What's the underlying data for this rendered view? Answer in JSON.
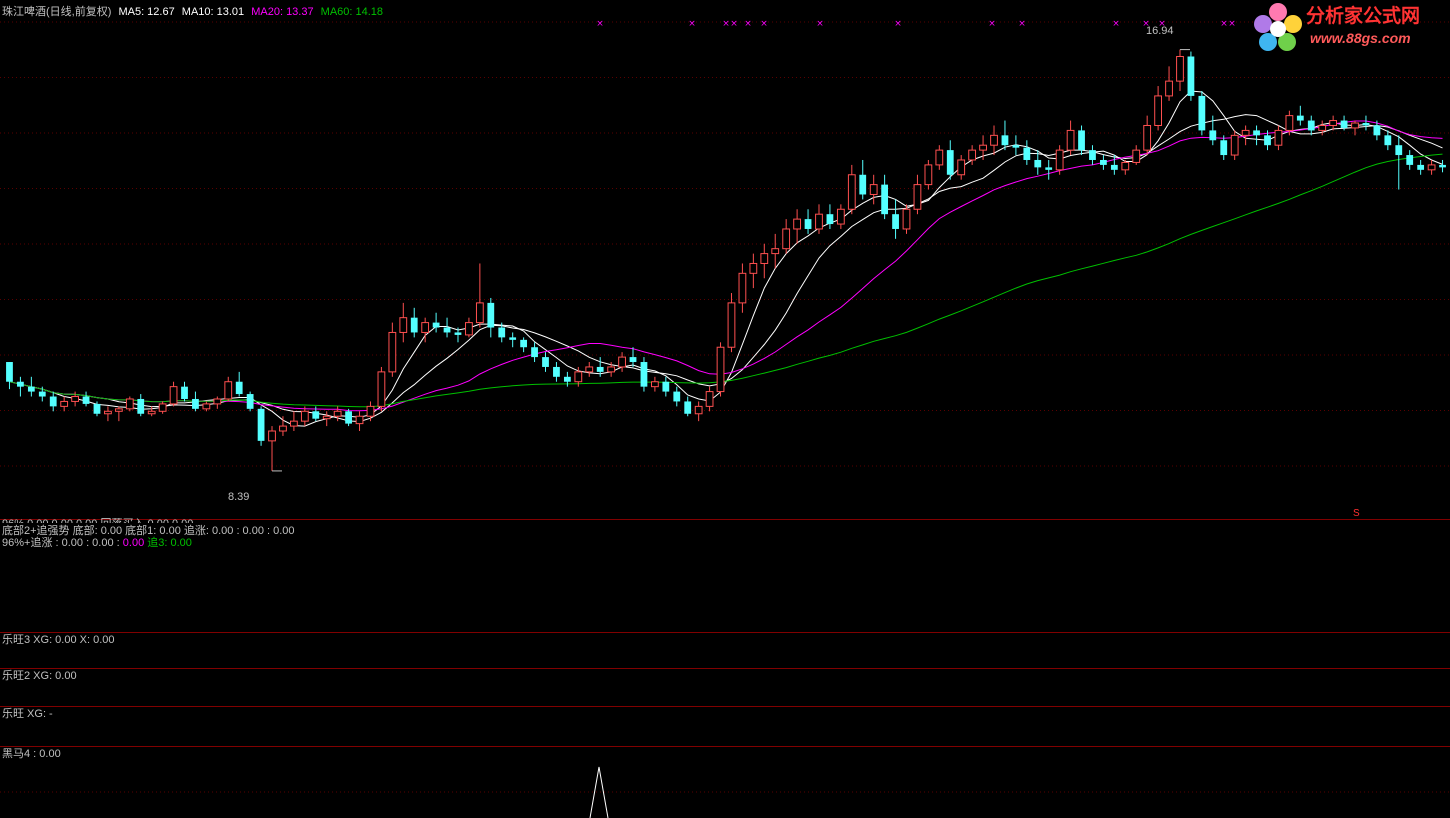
{
  "header": {
    "title": "珠江啤酒(日线,前复权)",
    "ma5": "MA5: 12.67",
    "ma10": "MA10: 13.01",
    "ma20": "MA20: 13.37",
    "ma60": "MA60: 14.18"
  },
  "logo": {
    "name": "分析家公式网",
    "url": "www.88gs.com"
  },
  "colors": {
    "up": "#ff5050",
    "down": "#54ffff",
    "ma5": "#ffffff",
    "ma10": "#ffffff",
    "ma20": "#ff00ff",
    "ma60": "#00c000",
    "divider": "#800000",
    "marker": "#ff00ff"
  },
  "panels": {
    "p1_line1": "底部2+追强势  底部: 0.00  底部1: 0.00  追涨: 0.00 : 0.00 : 0.00",
    "p1_line1_partial": "96%  0.00  0.00  0.00  回落买入  0.00  0.00",
    "p1_line2_a": "96%+追涨  : 0.00  : 0.00  :",
    "p1_line2_b": "0.00",
    "p1_line2_c": "追3: 0.00",
    "p2": "乐旺3  XG: 0.00  X: 0.00",
    "p3": "乐旺2  XG: 0.00",
    "p4": "乐旺  XG: -",
    "p5": "黑马4 : 0.00"
  },
  "annotations": {
    "low_label": "8.39",
    "high_label": "16.94",
    "s_marker": "S"
  },
  "chart_data": {
    "type": "candlestick",
    "title": "珠江啤酒(日线,前复权)",
    "ylim": [
      7.8,
      17.5
    ],
    "low": 8.39,
    "high": 16.94,
    "ohlc": [
      [
        10.6,
        10.6,
        10.05,
        10.2
      ],
      [
        10.2,
        10.3,
        9.9,
        10.1
      ],
      [
        10.1,
        10.3,
        9.9,
        10.0
      ],
      [
        10.0,
        10.1,
        9.8,
        9.9
      ],
      [
        9.9,
        10.0,
        9.6,
        9.7
      ],
      [
        9.7,
        9.9,
        9.6,
        9.8
      ],
      [
        9.8,
        10.0,
        9.7,
        9.9
      ],
      [
        9.9,
        10.0,
        9.7,
        9.75
      ],
      [
        9.75,
        9.8,
        9.5,
        9.55
      ],
      [
        9.55,
        9.7,
        9.4,
        9.6
      ],
      [
        9.6,
        9.7,
        9.4,
        9.65
      ],
      [
        9.65,
        9.9,
        9.6,
        9.85
      ],
      [
        9.85,
        9.95,
        9.5,
        9.55
      ],
      [
        9.55,
        9.7,
        9.5,
        9.6
      ],
      [
        9.6,
        9.8,
        9.55,
        9.75
      ],
      [
        9.75,
        10.2,
        9.7,
        10.1
      ],
      [
        10.1,
        10.2,
        9.8,
        9.85
      ],
      [
        9.85,
        10.0,
        9.6,
        9.65
      ],
      [
        9.65,
        9.8,
        9.6,
        9.75
      ],
      [
        9.75,
        9.9,
        9.65,
        9.85
      ],
      [
        9.85,
        10.3,
        9.8,
        10.2
      ],
      [
        10.2,
        10.4,
        9.9,
        9.95
      ],
      [
        9.95,
        10.0,
        9.6,
        9.65
      ],
      [
        9.65,
        9.7,
        8.9,
        9.0
      ],
      [
        9.0,
        9.3,
        8.39,
        9.2
      ],
      [
        9.2,
        9.5,
        9.1,
        9.3
      ],
      [
        9.3,
        9.6,
        9.2,
        9.4
      ],
      [
        9.4,
        9.7,
        9.3,
        9.6
      ],
      [
        9.6,
        9.7,
        9.4,
        9.45
      ],
      [
        9.45,
        9.6,
        9.3,
        9.5
      ],
      [
        9.5,
        9.7,
        9.4,
        9.6
      ],
      [
        9.6,
        9.65,
        9.3,
        9.35
      ],
      [
        9.35,
        9.6,
        9.2,
        9.5
      ],
      [
        9.5,
        9.8,
        9.4,
        9.7
      ],
      [
        9.7,
        10.5,
        9.6,
        10.4
      ],
      [
        10.4,
        11.4,
        10.3,
        11.2
      ],
      [
        11.2,
        11.8,
        11.0,
        11.5
      ],
      [
        11.5,
        11.7,
        11.1,
        11.2
      ],
      [
        11.2,
        11.5,
        11.0,
        11.4
      ],
      [
        11.4,
        11.6,
        11.2,
        11.3
      ],
      [
        11.3,
        11.5,
        11.1,
        11.2
      ],
      [
        11.2,
        11.3,
        11.0,
        11.15
      ],
      [
        11.15,
        11.5,
        11.1,
        11.4
      ],
      [
        11.4,
        12.6,
        11.3,
        11.8
      ],
      [
        11.8,
        11.9,
        11.1,
        11.3
      ],
      [
        11.3,
        11.4,
        11.0,
        11.1
      ],
      [
        11.1,
        11.2,
        10.9,
        11.05
      ],
      [
        11.05,
        11.1,
        10.8,
        10.9
      ],
      [
        10.9,
        11.0,
        10.6,
        10.7
      ],
      [
        10.7,
        10.8,
        10.4,
        10.5
      ],
      [
        10.5,
        10.6,
        10.2,
        10.3
      ],
      [
        10.3,
        10.4,
        10.1,
        10.2
      ],
      [
        10.2,
        10.5,
        10.1,
        10.4
      ],
      [
        10.4,
        10.6,
        10.3,
        10.5
      ],
      [
        10.5,
        10.7,
        10.3,
        10.4
      ],
      [
        10.4,
        10.6,
        10.3,
        10.5
      ],
      [
        10.5,
        10.8,
        10.4,
        10.7
      ],
      [
        10.7,
        10.9,
        10.5,
        10.6
      ],
      [
        10.6,
        10.7,
        10.0,
        10.1
      ],
      [
        10.1,
        10.3,
        10.0,
        10.2
      ],
      [
        10.2,
        10.3,
        9.9,
        10.0
      ],
      [
        10.0,
        10.1,
        9.7,
        9.8
      ],
      [
        9.8,
        9.9,
        9.5,
        9.55
      ],
      [
        9.55,
        9.8,
        9.4,
        9.7
      ],
      [
        9.7,
        10.1,
        9.6,
        10.0
      ],
      [
        10.0,
        11.0,
        9.9,
        10.9
      ],
      [
        10.9,
        12.0,
        10.8,
        11.8
      ],
      [
        11.8,
        12.6,
        11.6,
        12.4
      ],
      [
        12.4,
        12.8,
        12.1,
        12.6
      ],
      [
        12.6,
        13.0,
        12.3,
        12.8
      ],
      [
        12.8,
        13.2,
        12.5,
        12.9
      ],
      [
        12.9,
        13.5,
        12.8,
        13.3
      ],
      [
        13.3,
        13.7,
        13.0,
        13.5
      ],
      [
        13.5,
        13.7,
        13.2,
        13.3
      ],
      [
        13.3,
        13.8,
        13.2,
        13.6
      ],
      [
        13.6,
        13.8,
        13.3,
        13.4
      ],
      [
        13.4,
        13.8,
        13.3,
        13.7
      ],
      [
        13.7,
        14.6,
        13.6,
        14.4
      ],
      [
        14.4,
        14.7,
        13.9,
        14.0
      ],
      [
        14.0,
        14.4,
        13.8,
        14.2
      ],
      [
        14.2,
        14.4,
        13.5,
        13.6
      ],
      [
        13.6,
        13.9,
        13.1,
        13.3
      ],
      [
        13.3,
        13.8,
        13.2,
        13.7
      ],
      [
        13.7,
        14.4,
        13.6,
        14.2
      ],
      [
        14.2,
        14.7,
        14.1,
        14.6
      ],
      [
        14.6,
        15.0,
        14.5,
        14.9
      ],
      [
        14.9,
        15.1,
        14.3,
        14.4
      ],
      [
        14.4,
        14.8,
        14.3,
        14.7
      ],
      [
        14.7,
        15.0,
        14.6,
        14.9
      ],
      [
        14.9,
        15.2,
        14.7,
        15.0
      ],
      [
        15.0,
        15.4,
        14.8,
        15.2
      ],
      [
        15.2,
        15.5,
        14.9,
        15.0
      ],
      [
        15.0,
        15.2,
        14.8,
        14.95
      ],
      [
        14.95,
        15.1,
        14.6,
        14.7
      ],
      [
        14.7,
        14.9,
        14.4,
        14.55
      ],
      [
        14.55,
        14.7,
        14.3,
        14.5
      ],
      [
        14.5,
        15.0,
        14.4,
        14.9
      ],
      [
        14.9,
        15.5,
        14.8,
        15.3
      ],
      [
        15.3,
        15.4,
        14.8,
        14.9
      ],
      [
        14.9,
        15.0,
        14.6,
        14.7
      ],
      [
        14.7,
        14.8,
        14.5,
        14.6
      ],
      [
        14.6,
        14.8,
        14.4,
        14.5
      ],
      [
        14.5,
        14.7,
        14.4,
        14.65
      ],
      [
        14.65,
        15.0,
        14.6,
        14.9
      ],
      [
        14.9,
        15.6,
        14.8,
        15.4
      ],
      [
        15.4,
        16.2,
        15.3,
        16.0
      ],
      [
        16.0,
        16.6,
        15.9,
        16.3
      ],
      [
        16.3,
        16.94,
        16.1,
        16.8
      ],
      [
        16.8,
        16.9,
        15.9,
        16.0
      ],
      [
        16.0,
        16.1,
        15.2,
        15.3
      ],
      [
        15.3,
        15.6,
        15.0,
        15.1
      ],
      [
        15.1,
        15.2,
        14.7,
        14.8
      ],
      [
        14.8,
        15.3,
        14.7,
        15.2
      ],
      [
        15.2,
        15.4,
        15.0,
        15.3
      ],
      [
        15.3,
        15.4,
        15.0,
        15.2
      ],
      [
        15.2,
        15.3,
        14.9,
        15.0
      ],
      [
        15.0,
        15.4,
        14.9,
        15.3
      ],
      [
        15.3,
        15.7,
        15.2,
        15.6
      ],
      [
        15.6,
        15.8,
        15.4,
        15.5
      ],
      [
        15.5,
        15.6,
        15.2,
        15.3
      ],
      [
        15.3,
        15.5,
        15.2,
        15.4
      ],
      [
        15.4,
        15.6,
        15.3,
        15.5
      ],
      [
        15.5,
        15.6,
        15.3,
        15.35
      ],
      [
        15.35,
        15.5,
        15.2,
        15.45
      ],
      [
        15.45,
        15.6,
        15.3,
        15.4
      ],
      [
        15.4,
        15.5,
        15.1,
        15.2
      ],
      [
        15.2,
        15.3,
        14.9,
        15.0
      ],
      [
        15.0,
        15.2,
        14.1,
        14.8
      ],
      [
        14.8,
        14.9,
        14.5,
        14.6
      ],
      [
        14.6,
        14.7,
        14.4,
        14.5
      ],
      [
        14.5,
        14.7,
        14.4,
        14.6
      ],
      [
        14.6,
        14.7,
        14.45,
        14.55
      ]
    ]
  }
}
